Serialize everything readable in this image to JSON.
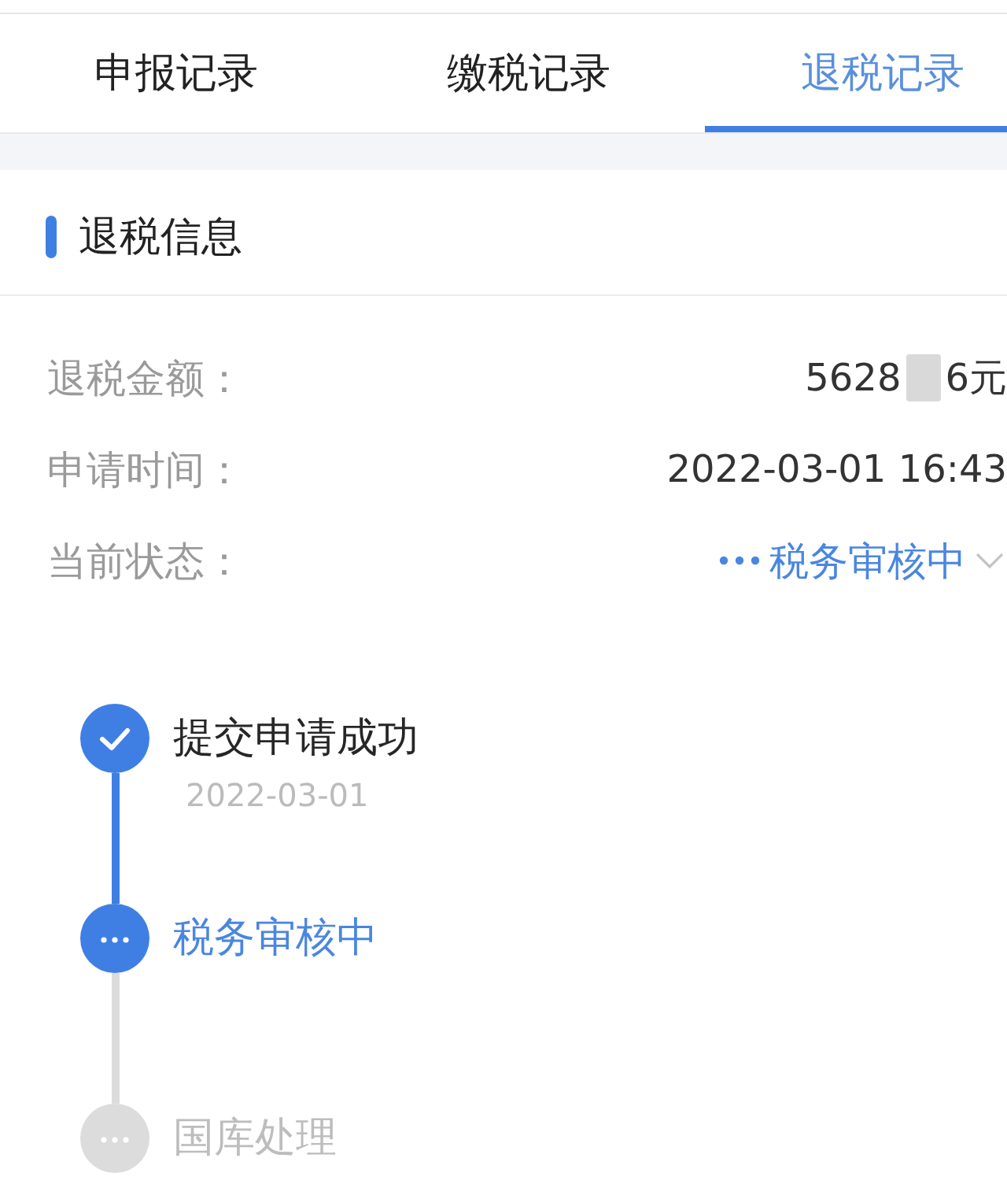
{
  "tabs": [
    {
      "label": "申报记录",
      "selected": false
    },
    {
      "label": "缴税记录",
      "selected": false
    },
    {
      "label": "退税记录",
      "selected": true
    }
  ],
  "section": {
    "title": "退税信息"
  },
  "info_rows": [
    {
      "kind": "redacted",
      "label": "退税金额：",
      "value_parts": [
        "5628",
        "6元"
      ]
    },
    {
      "kind": "text",
      "label": "申请时间：",
      "value": "2022-03-01 16:43"
    },
    {
      "kind": "status",
      "label": "当前状态：",
      "value": "税务审核中"
    }
  ],
  "timeline": [
    {
      "kind": "done",
      "title": "提交申请成功",
      "date": "2022-03-01"
    },
    {
      "kind": "active",
      "title": "税务审核中"
    },
    {
      "kind": "pending",
      "title": "国库处理"
    }
  ]
}
